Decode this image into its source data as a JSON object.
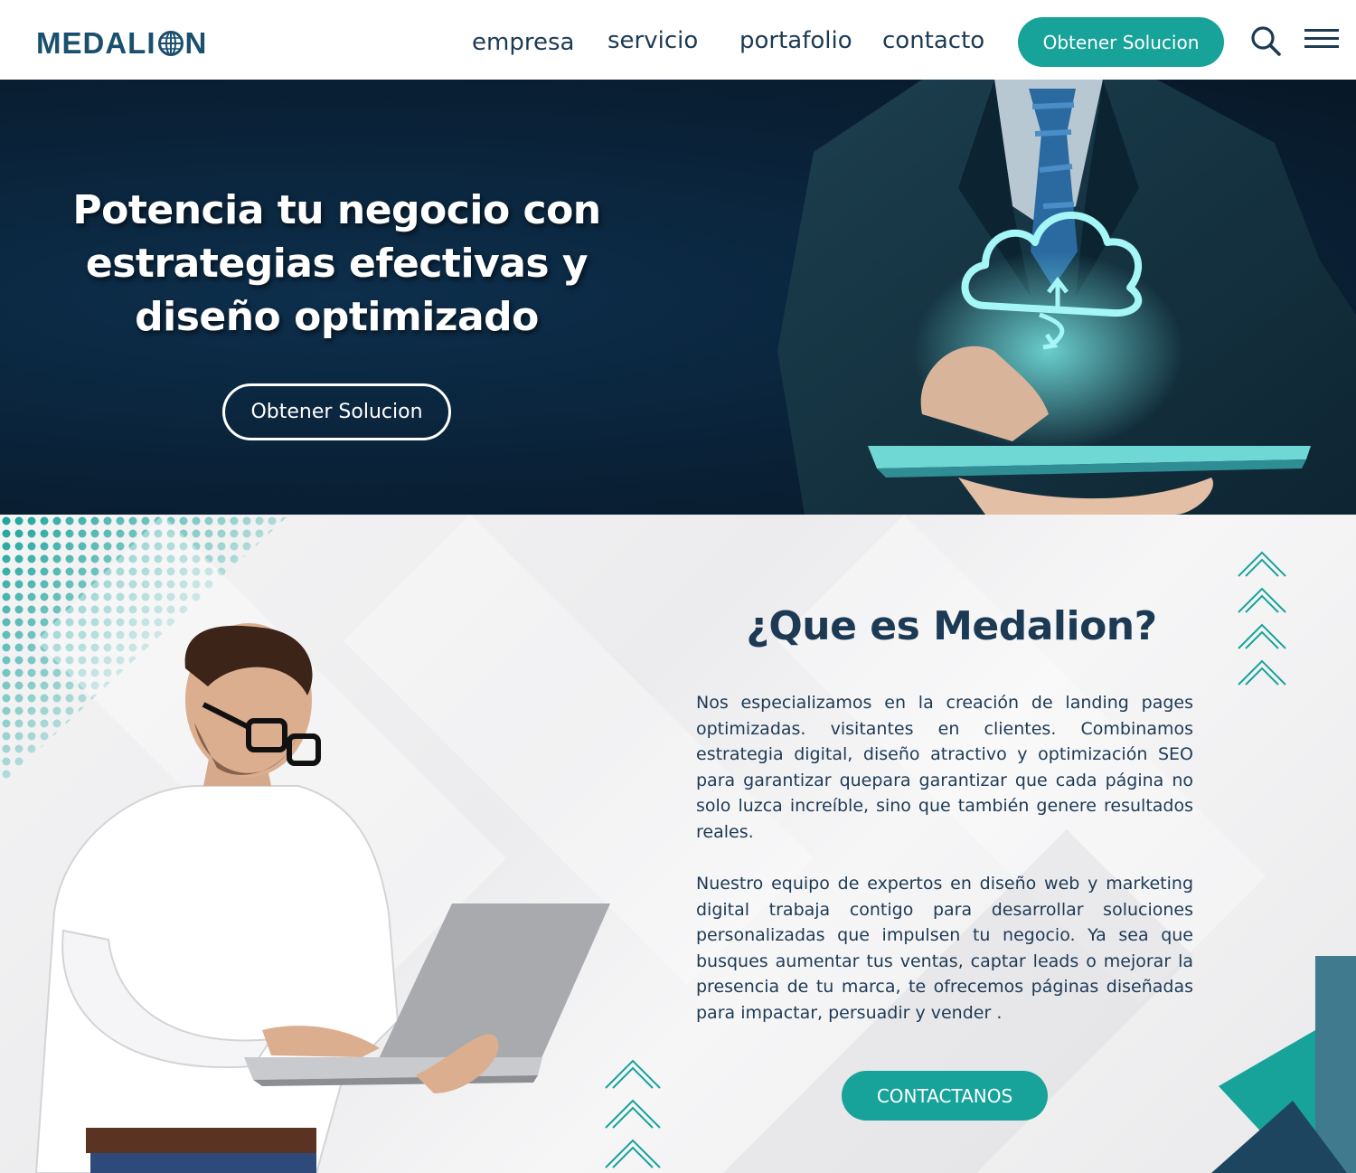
{
  "header": {
    "logo_text_left": "MEDALI",
    "logo_text_right": "N",
    "nav": [
      {
        "label": "empresa"
      },
      {
        "label": "servicio"
      },
      {
        "label": "portafolio"
      },
      {
        "label": "contacto"
      }
    ],
    "cta_label": "Obtener Solucion",
    "icons": [
      "search-icon",
      "hamburger-menu-icon"
    ]
  },
  "hero": {
    "title_line1": "Potencia tu negocio con",
    "title_line2": "estrategias efectivas y",
    "title_line3": "diseño optimizado",
    "button_label": "Obtener Solucion"
  },
  "about": {
    "title": "¿Que es Medalion?",
    "paragraph1": "Nos especializamos en la creación de landing pages optimizadas. visitantes en clientes. Combinamos estrategia digital, diseño atractivo y optimización SEO para garantizar quepara garantizar que cada página no solo luzca increíble, sino que también genere resultados reales.",
    "paragraph2": "Nuestro equipo de expertos en diseño web y marketing digital trabaja contigo para desarrollar soluciones personalizadas que impulsen tu negocio. Ya sea que busques aumentar tus ventas, captar leads o mejorar la presencia de tu marca, te ofrecemos páginas diseñadas para impactar, persuadir y vender .",
    "button_label": "CONTACTANOS"
  },
  "colors": {
    "accent": "#17a39a",
    "brand_dark": "#1d3a55",
    "hero_bg": "#0a2238"
  }
}
